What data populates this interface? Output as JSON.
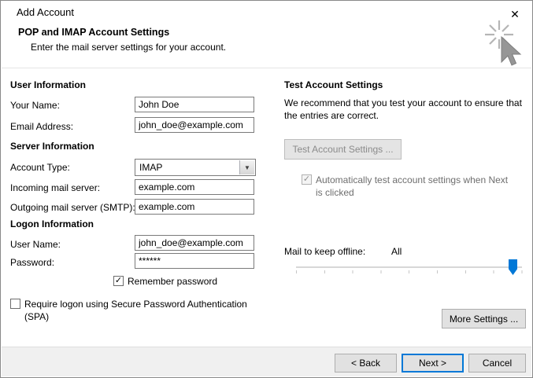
{
  "window": {
    "title": "Add Account",
    "close_glyph": "✕"
  },
  "header": {
    "title": "POP and IMAP Account Settings",
    "subtitle": "Enter the mail server settings for your account."
  },
  "user_information": {
    "section_title": "User Information",
    "your_name_label": "Your Name:",
    "your_name_value": "John Doe",
    "email_label": "Email Address:",
    "email_value": "john_doe@example.com"
  },
  "server_information": {
    "section_title": "Server Information",
    "account_type_label": "Account Type:",
    "account_type_value": "IMAP",
    "account_type_chevron": "▼",
    "incoming_label": "Incoming mail server:",
    "incoming_value": "example.com",
    "outgoing_label": "Outgoing mail server (SMTP):",
    "outgoing_value": "example.com"
  },
  "logon_information": {
    "section_title": "Logon Information",
    "user_name_label": "User Name:",
    "user_name_value": "john_doe@example.com",
    "password_label": "Password:",
    "password_value": "******",
    "remember_password_label": "Remember password",
    "remember_password_checked": true,
    "spa_label": "Require logon using Secure Password Authentication (SPA)",
    "spa_checked": false
  },
  "test_settings": {
    "section_title": "Test Account Settings",
    "description": "We recommend that you test your account to ensure that the entries are correct.",
    "test_button_label": "Test Account Settings ...",
    "test_button_enabled": false,
    "auto_test_label": "Automatically test account settings when Next is clicked",
    "auto_test_checked": true,
    "auto_test_enabled": false,
    "mail_offline_label": "Mail to keep offline:",
    "mail_offline_value": "All",
    "more_settings_label": "More Settings ..."
  },
  "footer": {
    "back_label": "< Back",
    "next_label": "Next >",
    "cancel_label": "Cancel"
  },
  "colors": {
    "accent": "#0078d7",
    "slider_handle": "#0078d7",
    "disabled_text": "#8b8b8b"
  }
}
